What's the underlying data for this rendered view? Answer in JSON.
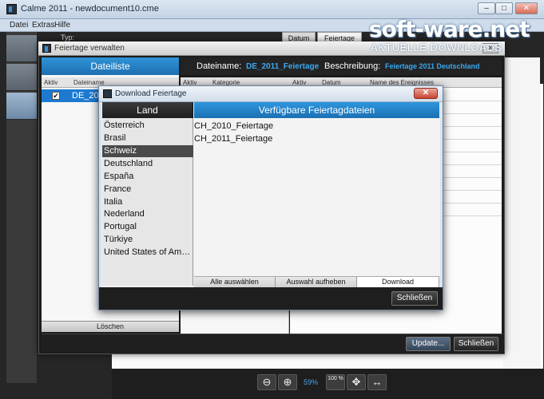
{
  "main_window": {
    "title": "Calme 2011 - newdocument10.cme",
    "buttons": {
      "minimize": "–",
      "maximize": "□",
      "close": "✕"
    },
    "menu": [
      "Datei",
      "Extras",
      "Hilfe"
    ],
    "typ_label": "Typ:",
    "bg_tabs": [
      "Datum",
      "Feiertage"
    ],
    "zoom_level": "59%",
    "tools": {
      "zoom_out": "⊖",
      "zoom_in": "⊕",
      "zoom_100": "100 %",
      "fit": "✥",
      "fit_width": "↔"
    }
  },
  "watermark": {
    "logo": "soft-ware.net",
    "sub": "AKTUELLE DOWNLOADS"
  },
  "feiertage_dialog": {
    "title": "Feiertage verwalten",
    "dateiliste_header": "Dateiliste",
    "datei_columns": [
      "Aktiv",
      "Dateiname"
    ],
    "datei_rows": [
      {
        "name": "DE_2011_Feiertage",
        "checked": true,
        "check_glyph": "✔"
      }
    ],
    "dateiname_label": "Dateiname:",
    "dateiname_value": "DE_2011_Feiertage",
    "beschreibung_label": "Beschreibung:",
    "beschreibung_value": "Feiertage 2011 Deutschland",
    "kategorie_columns": [
      "Aktiv",
      "Kategorie"
    ],
    "ereignis_columns": [
      "Aktiv",
      "Datum",
      "Name des Ereignisses"
    ],
    "loeschen_label": "Löschen",
    "update_label": "Update...",
    "schliessen_label": "Schließen"
  },
  "download_dialog": {
    "title": "Download Feiertage",
    "close_glyph": "✕",
    "land_header": "Land",
    "countries": [
      "Österreich",
      "Brasil",
      "Schweiz",
      "Deutschland",
      "España",
      "France",
      "Italia",
      "Nederland",
      "Portugal",
      "Türkiye",
      "United States of Ame..."
    ],
    "selected_country": "Schweiz",
    "available_header": "Verfügbare Feiertagdateien",
    "available_files": [
      "CH_2010_Feiertage",
      "CH_2011_Feiertage"
    ],
    "select_all_label": "Alle auswählen",
    "deselect_label": "Auswahl aufheben",
    "download_label": "Download",
    "close_label": "Schließen"
  }
}
